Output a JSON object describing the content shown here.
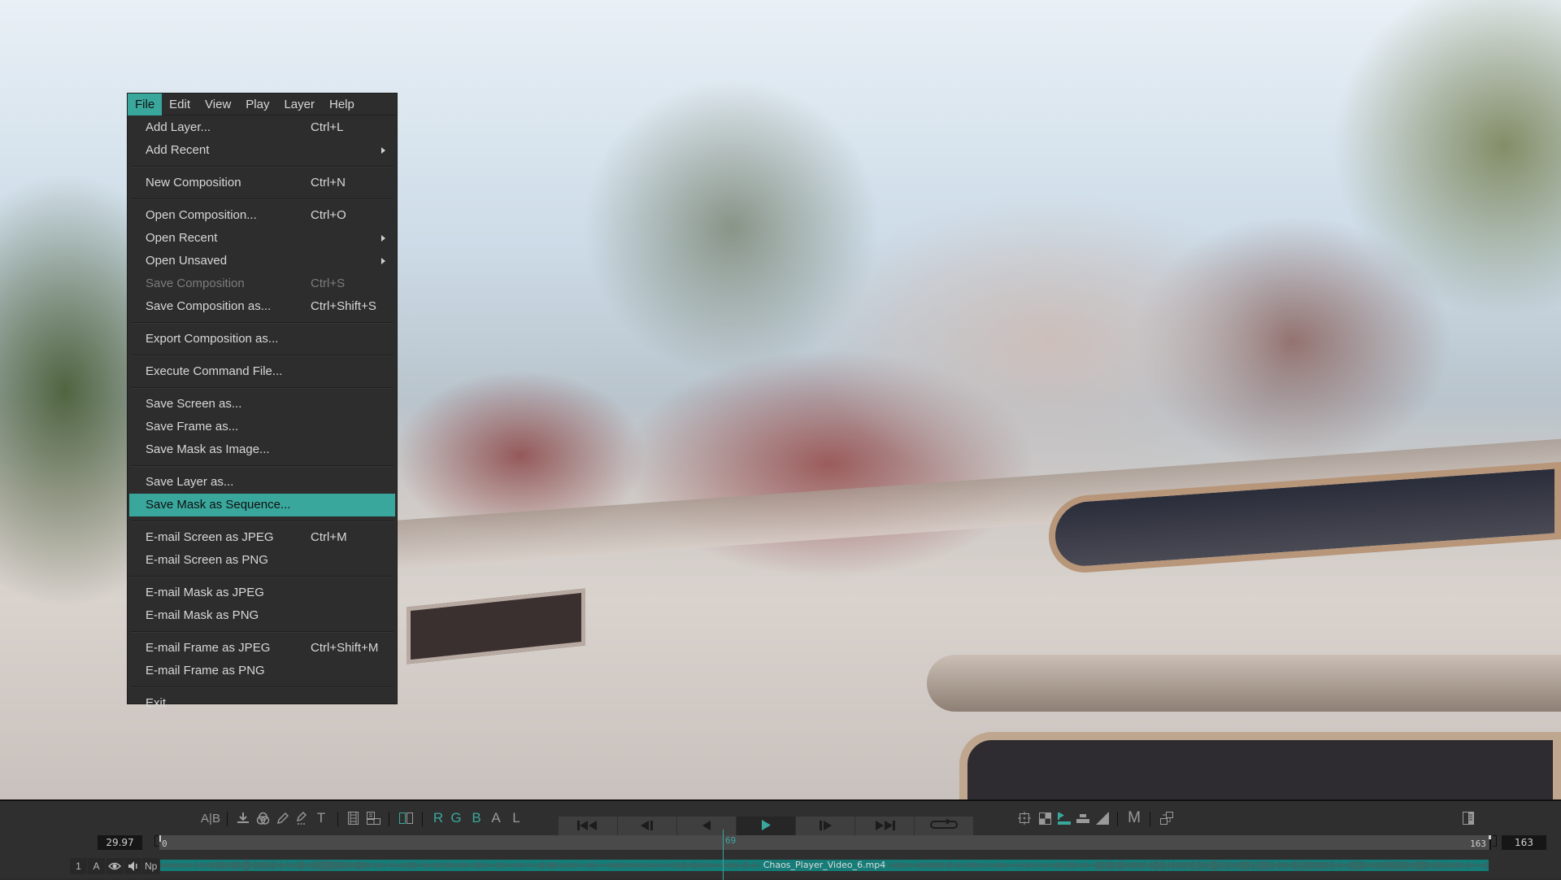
{
  "menubar": {
    "items": [
      {
        "label": "File",
        "active": true
      },
      {
        "label": "Edit",
        "active": false
      },
      {
        "label": "View",
        "active": false
      },
      {
        "label": "Play",
        "active": false
      },
      {
        "label": "Layer",
        "active": false
      },
      {
        "label": "Help",
        "active": false
      }
    ]
  },
  "file_menu": {
    "groups": [
      [
        {
          "label": "Add Layer...",
          "shortcut": "Ctrl+L"
        },
        {
          "label": "Add Recent",
          "submenu": true
        }
      ],
      [
        {
          "label": "New Composition",
          "shortcut": "Ctrl+N"
        }
      ],
      [
        {
          "label": "Open Composition...",
          "shortcut": "Ctrl+O"
        },
        {
          "label": "Open Recent",
          "submenu": true
        },
        {
          "label": "Open Unsaved",
          "submenu": true
        },
        {
          "label": "Save Composition",
          "shortcut": "Ctrl+S",
          "disabled": true
        },
        {
          "label": "Save Composition as...",
          "shortcut": "Ctrl+Shift+S"
        }
      ],
      [
        {
          "label": "Export Composition as..."
        }
      ],
      [
        {
          "label": "Execute Command File..."
        }
      ],
      [
        {
          "label": "Save Screen as..."
        },
        {
          "label": "Save Frame as..."
        },
        {
          "label": "Save Mask as Image..."
        }
      ],
      [
        {
          "label": "Save Layer as..."
        },
        {
          "label": "Save Mask as Sequence...",
          "highlighted": true
        }
      ],
      [
        {
          "label": "E-mail Screen as JPEG",
          "shortcut": "Ctrl+M"
        },
        {
          "label": "E-mail Screen as PNG"
        }
      ],
      [
        {
          "label": "E-mail Mask as JPEG"
        },
        {
          "label": "E-mail Mask as PNG"
        }
      ],
      [
        {
          "label": "E-mail Frame as JPEG",
          "shortcut": "Ctrl+Shift+M"
        },
        {
          "label": "E-mail Frame as PNG"
        }
      ],
      [
        {
          "label": "Exit"
        }
      ]
    ]
  },
  "toolbar": {
    "ab_compare": "A|B",
    "text_tool": "T",
    "channels": {
      "r": "R",
      "g": "G",
      "b": "B",
      "a": "A",
      "l": "L"
    },
    "m_label": "M",
    "transport_icons": [
      "first-frame-icon",
      "step-back-icon",
      "play-reverse-icon",
      "play-icon",
      "step-forward-icon",
      "last-frame-icon",
      "loop-icon"
    ],
    "active_transport": "play-icon",
    "accent_color": "#3aa79d"
  },
  "timeline": {
    "fps": "29.97",
    "start_frame": "0",
    "end_frame": "163",
    "current_frame": "69",
    "current_frame_fraction": 0.4233,
    "end_box": "163"
  },
  "layer": {
    "index": "1",
    "a_label": "A",
    "np_label": "Np",
    "name": "Chaos_Player_Video_6.mp4"
  }
}
